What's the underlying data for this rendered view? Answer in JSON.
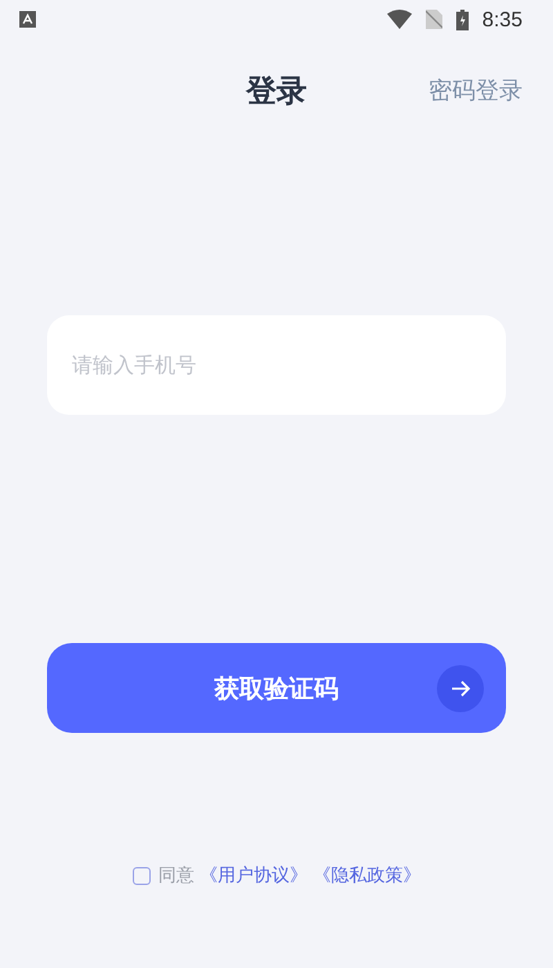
{
  "status_bar": {
    "time": "8:35"
  },
  "header": {
    "title": "登录",
    "action": "密码登录"
  },
  "phone_field": {
    "placeholder": "请输入手机号"
  },
  "submit_button": {
    "label": "获取验证码"
  },
  "agreement": {
    "checked": false,
    "prefix": "同意",
    "links": [
      "《用户协议》",
      "《隐私政策》"
    ]
  }
}
